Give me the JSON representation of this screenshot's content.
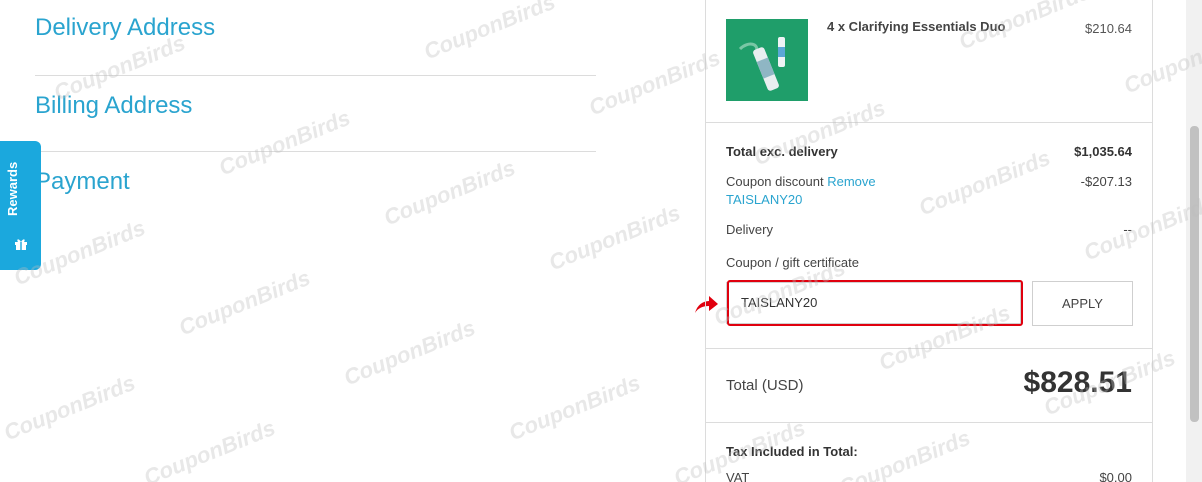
{
  "sections": {
    "delivery": "Delivery Address",
    "billing": "Billing Address",
    "payment": "Payment"
  },
  "rewards": {
    "label": "Rewards",
    "icon": "gift-icon"
  },
  "product": {
    "name": "4 x Clarifying Essentials Duo",
    "price": "$210.64"
  },
  "summary": {
    "total_exc_label": "Total exc. delivery",
    "total_exc_value": "$1,035.64",
    "coupon_label": "Coupon discount",
    "coupon_remove": "Remove",
    "coupon_code": "TAISLANY20",
    "coupon_value": "-$207.13",
    "delivery_label": "Delivery",
    "delivery_value": "--",
    "gift_label": "Coupon / gift certificate",
    "coupon_input_value": "TAISLANY20",
    "apply_label": "APPLY",
    "total_label": "Total (USD)",
    "total_value": "$828.51",
    "tax_label": "Tax Included in Total:",
    "vat_label": "VAT",
    "vat_value": "$0.00"
  },
  "watermark_text": "CouponBirds",
  "colors": {
    "accent": "#2aa4cf",
    "rewards": "#1ba8dd",
    "highlight": "#e0000e"
  }
}
